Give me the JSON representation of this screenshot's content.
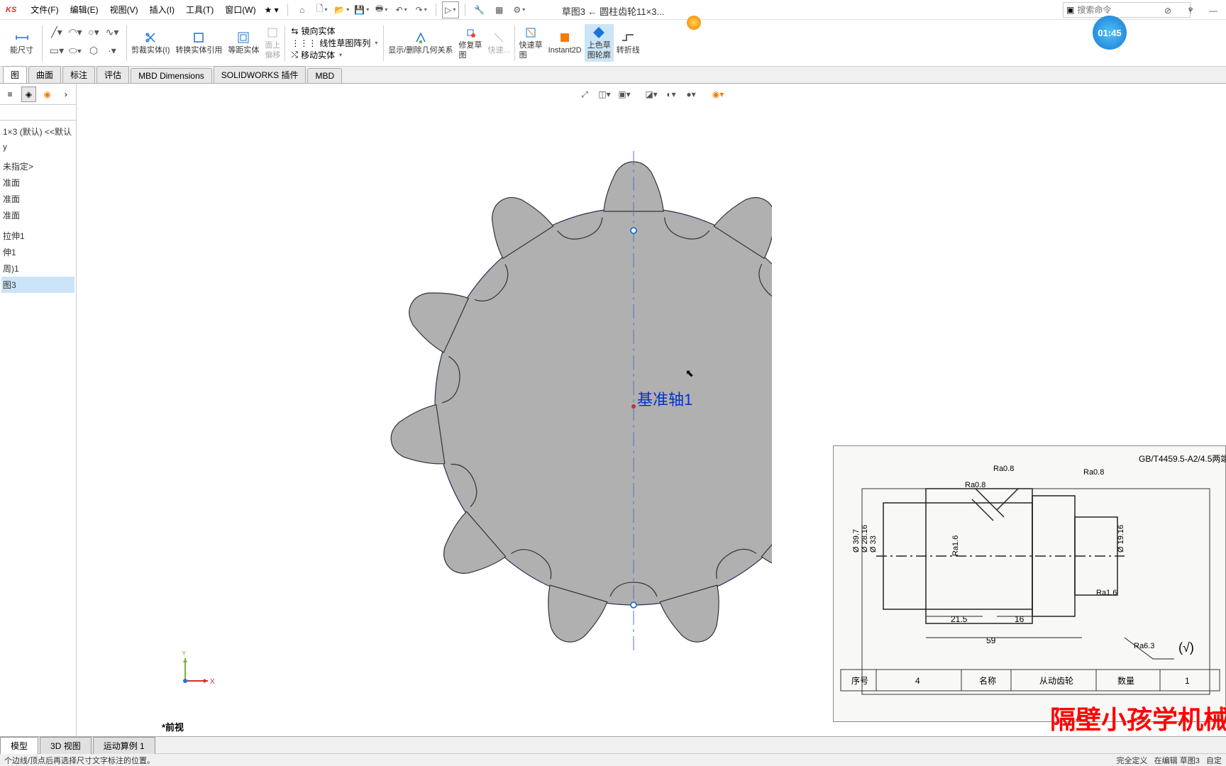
{
  "app": {
    "logo": "KS"
  },
  "menus": {
    "file": "文件(F)",
    "edit": "编辑(E)",
    "view": "视图(V)",
    "insert": "插入(I)",
    "tools": "工具(T)",
    "window": "窗口(W)"
  },
  "doc_title": "草图3 ← 圆柱齿轮11×3...",
  "search": {
    "placeholder": "搜索命令"
  },
  "ribbon": {
    "size": "能尺寸",
    "trim": "剪裁实体(I)",
    "convert": "转换实体引用",
    "offset": "等距实体",
    "face": "面上\n偏移",
    "mirror": "镜向实体",
    "linear": "线性草图阵列",
    "move": "移动实体",
    "display": "显示/删除几何关系",
    "repair": "修复草\n图",
    "quick": "快速...",
    "rapid": "快速草\n图",
    "instant": "Instant2D",
    "shaded": "上色草\n图轮廓",
    "jog": "转折线"
  },
  "tabs": {
    "sketch": "图",
    "surface": "曲面",
    "annotate": "标注",
    "evaluate": "评估",
    "mbd": "MBD Dimensions",
    "addins": "SOLIDWORKS 插件",
    "mbd2": "MBD"
  },
  "tree": {
    "root": "1×3 (默认) <<默认",
    "items": [
      "y",
      "",
      "未指定>",
      "准面",
      "准面",
      "准面",
      "",
      "拉伸1",
      "伸1",
      "周)1",
      "图3"
    ]
  },
  "axis_label": "基准轴1",
  "view_label": "*前视",
  "triad": {
    "x": "X",
    "y": "Y"
  },
  "timer": "01:45",
  "drawing": {
    "standard": "GB/T4459.5-A2/4.5两端",
    "ra08": "Ra0.8",
    "ra16": "Ra1.6",
    "ra63": "Ra6.3",
    "dim215": "21.5",
    "dim16": "16",
    "dim59": "59",
    "dia1": "Ø 39.7",
    "dia2": "Ø 28.16",
    "dia3": "Ø 33",
    "dia4": "Ø 19.16",
    "col1": "序号",
    "val1": "4",
    "col2": "名称",
    "val2": "从动齿轮",
    "col3": "数量",
    "val3": "1",
    "check": "(√)"
  },
  "watermark": "隔壁小孩学机械",
  "bottom_tabs": {
    "model": "模型",
    "view3d": "3D 视图",
    "motion": "运动算例 1"
  },
  "status": {
    "hint": "个边线/顶点后再选择尺寸文字标注的位置。",
    "defined": "完全定义",
    "editing": "在编辑 草图3",
    "custom": "自定"
  }
}
